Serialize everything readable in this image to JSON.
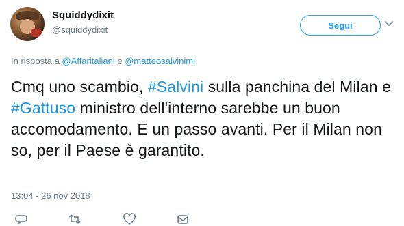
{
  "author": {
    "name": "Squiddydixit",
    "handle": "@squiddydixit"
  },
  "follow_label": "Segui",
  "reply": {
    "prefix": "In risposta a",
    "user1": "@Affaritaliani",
    "conj": "e",
    "user2": "@matteosalvinimi"
  },
  "tweet": {
    "t1": "Cmq uno scambio, ",
    "tag1": "#Salvini",
    "t2": " sulla panchina del Milan e ",
    "tag2": "#Gattuso",
    "t3": " ministro dell'interno sarebbe un buon accomodamento. E un passo avanti. Per il Milan non so, per il Paese è garantito."
  },
  "timestamp": "13:04 - 26 nov 2018",
  "icons": [
    "chevron-down-icon",
    "reply-icon",
    "retweet-icon",
    "like-icon",
    "message-icon"
  ],
  "colors": {
    "accent": "#1da1f2",
    "link": "#1b95e0",
    "muted": "#657786",
    "text": "#14171a"
  }
}
